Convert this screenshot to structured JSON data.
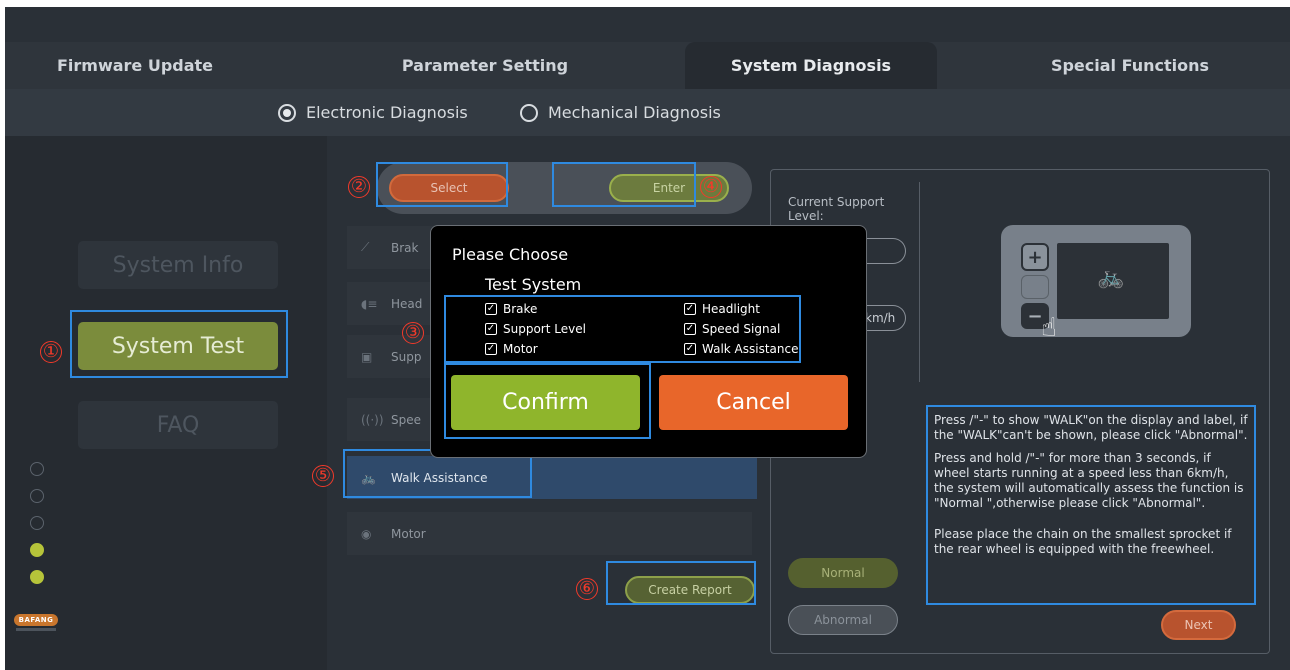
{
  "tabs": [
    {
      "label": "Firmware Update"
    },
    {
      "label": "Parameter Setting"
    },
    {
      "label": "System Diagnosis"
    },
    {
      "label": "Special Functions"
    }
  ],
  "diagnosis_modes": {
    "electronic": "Electronic Diagnosis",
    "mechanical": "Mechanical Diagnosis",
    "selected": "Electronic Diagnosis"
  },
  "leftnav": {
    "system_info": "System Info",
    "system_test": "System Test",
    "faq": "FAQ",
    "logo": "BAFANG"
  },
  "controls": {
    "select": "Select",
    "enter": "Enter",
    "create_report": "Create Report"
  },
  "test_items": [
    {
      "label": "Brake",
      "icon": "brake-icon"
    },
    {
      "label": "Headlight",
      "icon": "headlight-icon"
    },
    {
      "label": "Support Level",
      "icon": "support-level-icon"
    },
    {
      "label": "Speed Signal",
      "icon": "speed-signal-icon"
    },
    {
      "label": "Walk Assistance",
      "icon": "walk-assistance-icon"
    },
    {
      "label": "Motor",
      "icon": "motor-icon"
    }
  ],
  "visible_item_text": {
    "brake": "Brak",
    "headlight": "Head",
    "support": "Supp",
    "speed": "Spee",
    "walk": "Walk Assistance",
    "motor": "Motor"
  },
  "right_panel": {
    "current_support_label": "Current Support Level:",
    "speed_unit": "km/h",
    "instructions": [
      "Press /\"-\" to show \"WALK\"on the display and label, if the \"WALK\"can't be shown, please click \"Abnormal\".",
      "Press  and hold /\"-\" for more than 3 seconds, if wheel starts running at a speed less than 6km/h, the system will automatically assess the function is \"Normal  \",otherwise please click \"Abnormal\".",
      "Please place the chain on the smallest sprocket if the rear wheel is equipped with the freewheel."
    ],
    "normal": "Normal",
    "abnormal": "Abnormal",
    "next": "Next"
  },
  "modal": {
    "title_line1": "Please Choose",
    "title_line2": "Test System",
    "options": [
      {
        "label": "Brake",
        "checked": true
      },
      {
        "label": "Headlight",
        "checked": true
      },
      {
        "label": "Support Level",
        "checked": true
      },
      {
        "label": "Speed Signal",
        "checked": true
      },
      {
        "label": "Motor",
        "checked": true
      },
      {
        "label": "Walk Assistance",
        "checked": true
      }
    ],
    "confirm": "Confirm",
    "cancel": "Cancel"
  },
  "annotations": [
    "①",
    "②",
    "③",
    "④",
    "⑤",
    "⑥"
  ],
  "colors": {
    "accent_blue": "#2f8ae0",
    "annotation_red": "#f23a2a",
    "confirm_green": "#8fb52c",
    "cancel_orange": "#e8662a"
  }
}
